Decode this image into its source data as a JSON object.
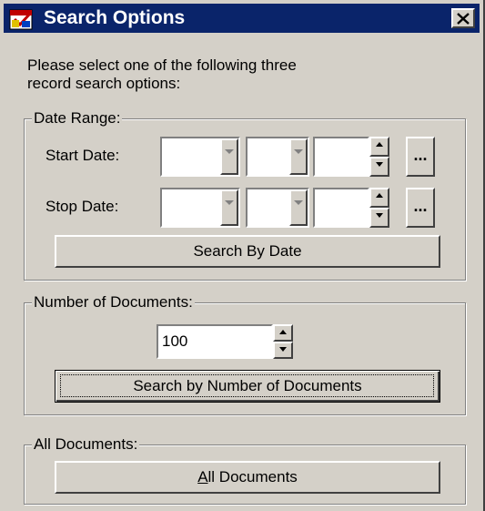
{
  "window": {
    "title": "Search Options",
    "icon": "app-calendar-icon",
    "close_icon": "close-icon"
  },
  "intro": {
    "line1": "Please select one of the following three",
    "line2": "record search options:"
  },
  "date_range": {
    "legend": "Date Range:",
    "start_label": "Start Date:",
    "stop_label": "Stop Date:",
    "start_values": {
      "month": "",
      "day": "",
      "year": ""
    },
    "stop_values": {
      "month": "",
      "day": "",
      "year": ""
    },
    "ellipsis": "...",
    "search_button": "Search By Date"
  },
  "number_of_documents": {
    "legend": "Number of Documents:",
    "value": "100",
    "search_button": "Search by Number of Documents"
  },
  "all_documents": {
    "legend": "All Documents:",
    "button_accel": "A",
    "button_rest": "ll Documents"
  }
}
